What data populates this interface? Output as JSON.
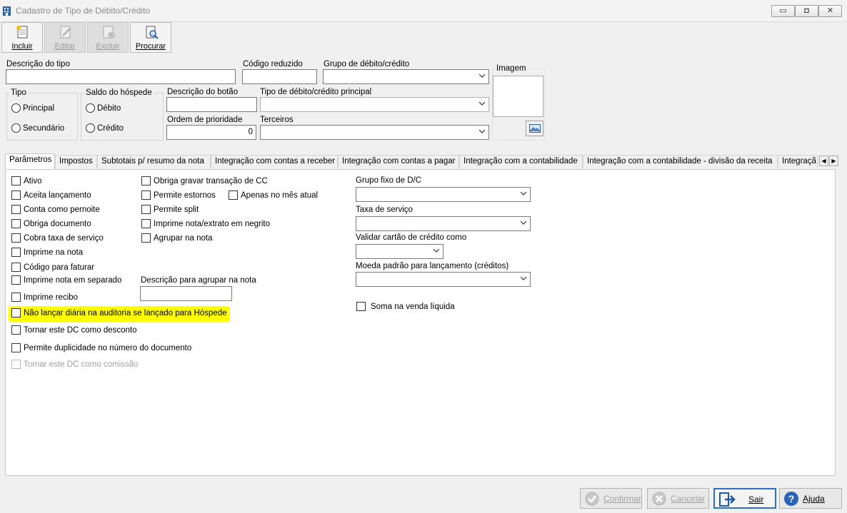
{
  "window": {
    "title": "Cadastro de Tipo de Débito/Crédito",
    "minimize_glyph": "▭",
    "maximize_glyph": "◘",
    "close_glyph": "✕"
  },
  "toolbar": {
    "incluir": "Incluir",
    "editar": "Editar",
    "excluir": "Excluir",
    "procurar": "Procurar"
  },
  "form": {
    "descricao_tipo_label": "Descrição do tipo",
    "descricao_tipo_value": "",
    "codigo_reduzido_label": "Código reduzido",
    "codigo_reduzido_value": "",
    "grupo_label": "Grupo de débito/crédito",
    "grupo_value": "",
    "imagem_label": "Imagem",
    "tipo_label": "Tipo",
    "tipo_options": [
      "Principal",
      "Secundário"
    ],
    "saldo_label": "Saldo do hóspede",
    "saldo_options": [
      "Débito",
      "Crédito"
    ],
    "descricao_botao_label": "Descrição do botão",
    "descricao_botao_value": "",
    "tipo_principal_label": "Tipo de débito/crédito principal",
    "tipo_principal_value": "",
    "ordem_label": "Ordem de prioridade",
    "ordem_value": "0",
    "terceiros_label": "Terceiros",
    "terceiros_value": ""
  },
  "tabs": [
    "Parâmetros",
    "Impostos",
    "Subtotais p/ resumo da nota",
    "Integração com contas a receber",
    "Integração com contas a pagar",
    "Integração com a contabilidade",
    "Integração com a contabilidade - divisão da receita",
    "Integraçã"
  ],
  "tab_scroll": {
    "left": "◀",
    "right": "▶"
  },
  "params": {
    "col1": [
      "Ativo",
      "Aceita lançamento",
      "Conta como pernoite",
      "Obriga documento",
      "Cobra taxa de serviço",
      "Imprime na nota",
      "Código para faturar",
      "Imprime nota em separado",
      "Imprime recibo",
      "Não lançar diária na auditoria se lançado para Hóspede",
      "Tornar este DC como desconto",
      "Permite duplicidade no número do documento",
      "Tornar este DC como comissão"
    ],
    "col2": [
      "Obriga gravar transação de CC",
      "Permite estornos",
      "Permite split",
      "Imprime nota/extrato em negrito",
      "Agrupar na nota"
    ],
    "apenas_mes": "Apenas no mês atual",
    "descricao_agrupar_label": "Descrição para agrupar na nota",
    "descricao_agrupar_value": "",
    "grupo_fixo_label": "Grupo fixo de D/C",
    "grupo_fixo_value": "",
    "taxa_servico_label": "Taxa de serviço",
    "taxa_servico_value": "",
    "validar_cartao_label": "Validar cartão de crédito como",
    "validar_cartao_value": "",
    "moeda_label": "Moeda padrão para lançamento (créditos)",
    "moeda_value": "",
    "soma_venda": "Soma na venda líquida",
    "highlight_color": "#ffff00"
  },
  "footer": {
    "confirmar": "Confirmar",
    "cancelar": "Cancelar",
    "sair": "Sair",
    "ajuda": "Ajuda"
  }
}
